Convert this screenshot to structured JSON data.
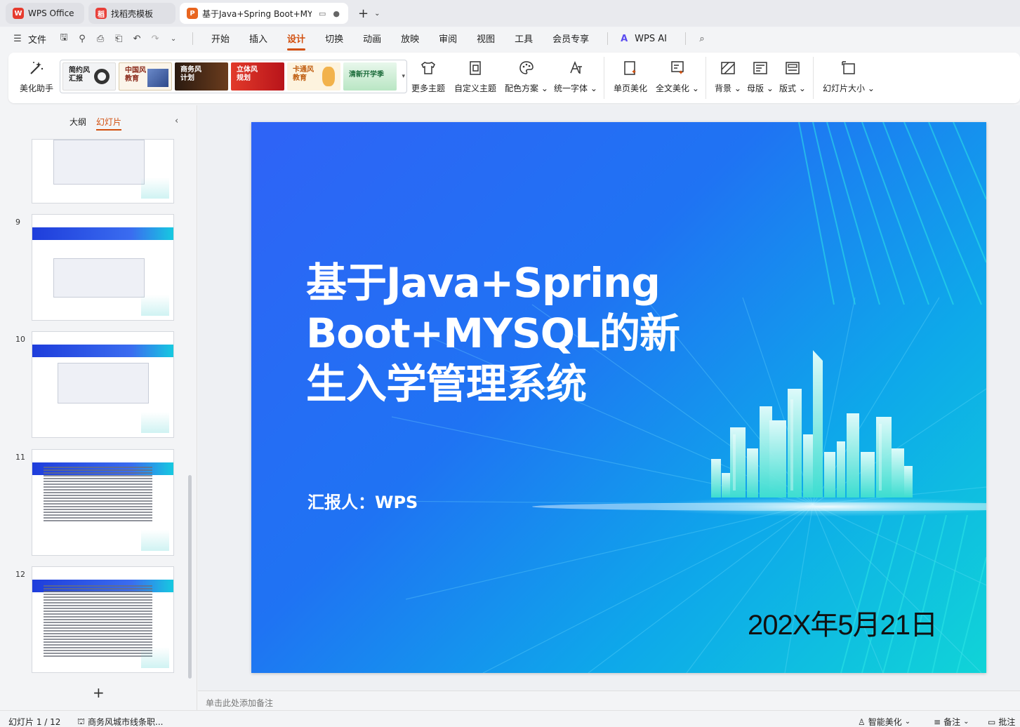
{
  "tabs": [
    {
      "label": "WPS Office",
      "logo": "wps-logo-icon",
      "active": false
    },
    {
      "label": "找稻壳模板",
      "logo": "docer-logo-icon",
      "active": false
    },
    {
      "label": "基于Java+Spring Boot+MY",
      "logo": "presentation-logo-icon",
      "active": true
    }
  ],
  "menubar": {
    "file_label": "文件",
    "tabs": [
      "开始",
      "插入",
      "设计",
      "切换",
      "动画",
      "放映",
      "审阅",
      "视图",
      "工具",
      "会员专享"
    ],
    "active_tab": "设计",
    "ai_label": "WPS AI"
  },
  "ribbon": {
    "beautify_label": "美化助手",
    "themes": [
      {
        "label": "简约风\n汇报",
        "style": "simple"
      },
      {
        "label": "中国风\n教育",
        "style": "chinese"
      },
      {
        "label": "商务风\n计划",
        "style": "business"
      },
      {
        "label": "立体风\n规划",
        "style": "3d"
      },
      {
        "label": "卡通风\n教育",
        "style": "cartoon"
      },
      {
        "label": "清新开学季",
        "style": "fresh"
      }
    ],
    "buttons": [
      {
        "label": "更多主题",
        "icon": "tshirt-icon"
      },
      {
        "label": "自定义主题",
        "icon": "custom-theme-icon"
      },
      {
        "label": "配色方案",
        "icon": "palette-icon",
        "dropdown": true
      },
      {
        "label": "统一字体",
        "icon": "font-icon",
        "dropdown": true
      },
      {
        "label": "单页美化",
        "icon": "page-beautify-icon"
      },
      {
        "label": "全文美化",
        "icon": "doc-beautify-icon",
        "dropdown": true
      },
      {
        "label": "背景",
        "icon": "background-icon",
        "dropdown": true
      },
      {
        "label": "母版",
        "icon": "master-icon",
        "dropdown": true
      },
      {
        "label": "版式",
        "icon": "layout-icon",
        "dropdown": true
      },
      {
        "label": "幻灯片大小",
        "icon": "slide-size-icon",
        "dropdown": true
      }
    ]
  },
  "left_panel": {
    "tab_outline": "大纲",
    "tab_slides": "幻灯片",
    "thumb_numbers": [
      "9",
      "10",
      "11",
      "12"
    ]
  },
  "slide": {
    "title": "基于Java+Spring Boot+MYSQL的新生入学管理系统",
    "reporter": "汇报人：WPS",
    "date": "202X年5月21日"
  },
  "notes_placeholder": "单击此处添加备注",
  "status": {
    "slide_counter": "幻灯片 1 / 12",
    "theme_name": "商务风城市线条职...",
    "smart_beautify": "智能美化",
    "notes_label": "备注",
    "comments_label": "批注"
  },
  "colors": {
    "accent": "#d24f0e",
    "slide_blue": "#2f63f6",
    "slide_cyan": "#10d4d7"
  }
}
